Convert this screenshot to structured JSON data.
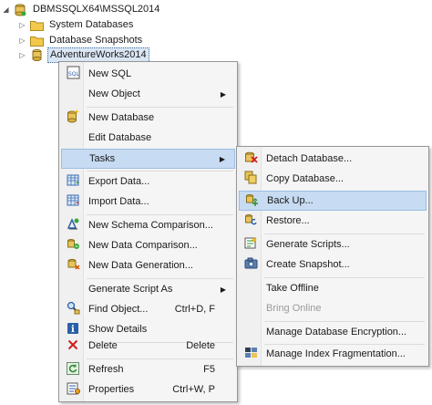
{
  "tree": {
    "server": "DBMSSQLX64\\MSSQL2014",
    "system_databases": "System Databases",
    "database_snapshots": "Database Snapshots",
    "selected_db": "AdventureWorks2014"
  },
  "context_menu": {
    "new_sql": "New SQL",
    "new_object": "New Object",
    "new_database": "New Database",
    "edit_database": "Edit Database",
    "tasks": "Tasks",
    "export_data": "Export Data...",
    "import_data": "Import Data...",
    "new_schema_comparison": "New Schema Comparison...",
    "new_data_comparison": "New Data Comparison...",
    "new_data_generation": "New Data Generation...",
    "generate_script_as": "Generate Script As",
    "find_object": "Find Object...",
    "find_object_shortcut": "Ctrl+D, F",
    "show_details": "Show Details",
    "delete": "Delete",
    "delete_shortcut": "Delete",
    "refresh": "Refresh",
    "refresh_shortcut": "F5",
    "properties": "Properties",
    "properties_shortcut": "Ctrl+W, P"
  },
  "tasks_menu": {
    "detach_database": "Detach Database...",
    "copy_database": "Copy Database...",
    "back_up": "Back Up...",
    "restore": "Restore...",
    "generate_scripts": "Generate Scripts...",
    "create_snapshot": "Create Snapshot...",
    "take_offline": "Take Offline",
    "bring_online": "Bring Online",
    "manage_encryption": "Manage Database Encryption...",
    "manage_fragmentation": "Manage Index Fragmentation..."
  },
  "highlighted": {
    "context_menu": "Tasks",
    "tasks_menu": "Back Up..."
  }
}
